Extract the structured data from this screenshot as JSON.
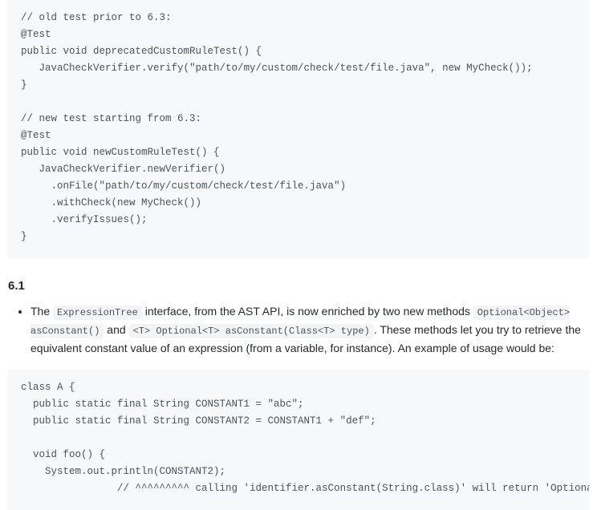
{
  "code_block_1": "// old test prior to 6.3:\n@Test\npublic void deprecatedCustomRuleTest() {\n   JavaCheckVerifier.verify(\"path/to/my/custom/check/test/file.java\", new MyCheck());\n}\n\n// new test starting from 6.3:\n@Test\npublic void newCustomRuleTest() {\n   JavaCheckVerifier.newVerifier()\n     .onFile(\"path/to/my/custom/check/test/file.java\")\n     .withCheck(new MyCheck())\n     .verifyIssues();\n}",
  "section_heading": "6.1",
  "bullet_1": {
    "t1": "The ",
    "c1": "ExpressionTree",
    "t2": " interface, from the AST API, is now enriched by two new methods ",
    "c2": "Optional<Object> asConstant()",
    "t3": " and ",
    "c3": "<T> Optional<T> asConstant(Class<T> type)",
    "t4": ". These methods let you try to retrieve the equivalent constant value of an expression (from a variable, for instance). An example of usage would be:"
  },
  "code_block_2": "class A {\n  public static final String CONSTANT1 = \"abc\";\n  public static final String CONSTANT2 = CONSTANT1 + \"def\";\n\n  void foo() {\n    System.out.println(CONSTANT2);\n                // ^^^^^^^^^ calling 'identifier.asConstant(String.class)' will return 'Optional.of(\"abcdef\")'"
}
